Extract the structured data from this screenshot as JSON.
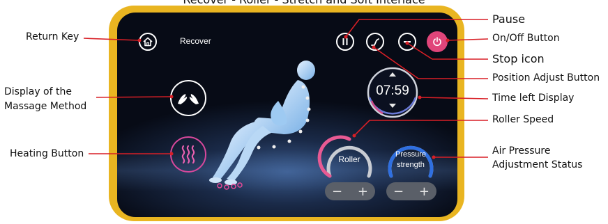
{
  "caption": "Recover - Roller - Stretch and Soft Interlace",
  "screen": {
    "mode_title": "Recover",
    "timer": "07:59",
    "roller_label": "Roller",
    "pressure_label": "Pressure strength",
    "minus": "−",
    "plus": "+"
  },
  "callouts": {
    "return_key": "Return Key",
    "massage_method": "Display of the\nMassage Method",
    "heating": "Heating Button",
    "pause": "Pause",
    "on_off": "On/Off Button",
    "stop": "Stop icon",
    "position_adjust": "Position Adjust Button",
    "time_left": "Time left Display",
    "roller_speed": "Roller Speed",
    "air_pressure": "Air Pressure\nAdjustment Status"
  },
  "colors": {
    "frame": "#e9b521",
    "leader": "#d81f26",
    "power": "#e0457a",
    "roller_arc": "#e85a93",
    "pressure_arc": "#2f6fe0",
    "heating": "#d8489c"
  },
  "icons": [
    "home-icon",
    "hands-icon",
    "heat-waves-icon",
    "pause-icon",
    "position-icon",
    "stop-icon",
    "power-icon",
    "up-arrow-icon",
    "down-arrow-icon"
  ]
}
